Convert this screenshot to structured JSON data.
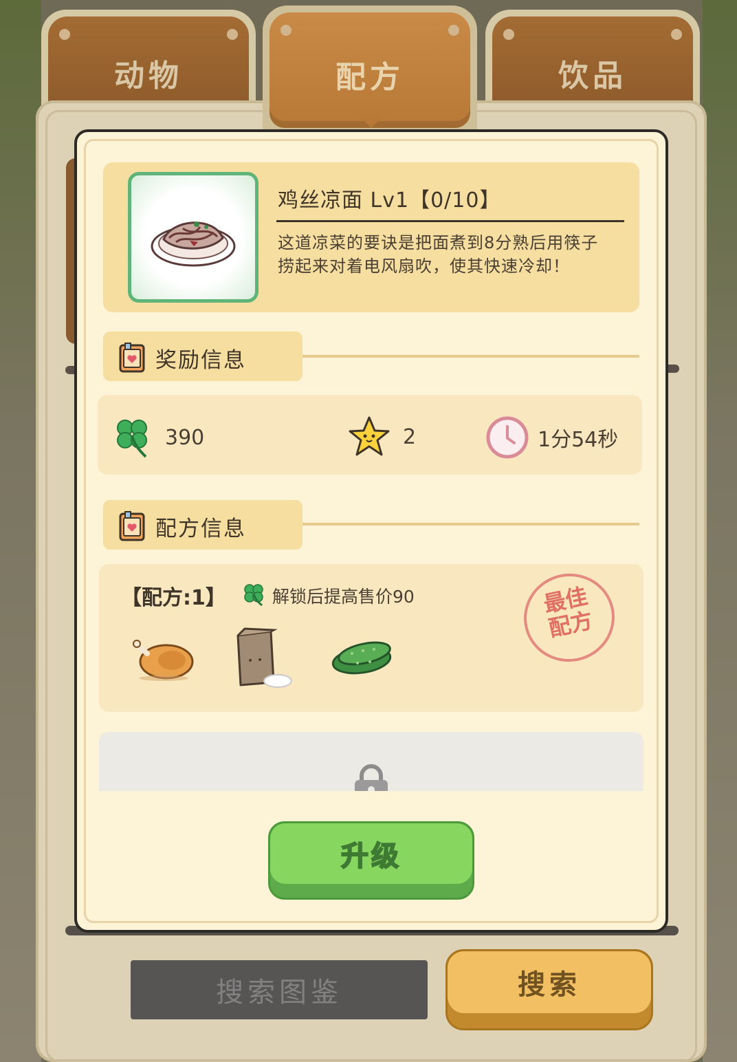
{
  "tabs": [
    {
      "label": "动物",
      "active": false
    },
    {
      "label": "配方",
      "active": true
    },
    {
      "label": "饮品",
      "active": false
    }
  ],
  "dish": {
    "image_icon": "noodle-plate-icon",
    "title": "鸡丝凉面 Lv1【0/10】",
    "description": "这道凉菜的要诀是把面煮到8分熟后用筷子捞起来对着电风扇吹，使其快速冷却！"
  },
  "reward_section": {
    "heading": "奖励信息",
    "clover": "390",
    "stars": "2",
    "time": "1分54秒"
  },
  "recipe_section": {
    "heading": "配方信息",
    "recipe_label": "【配方:1】",
    "unlock_note": "解锁后提高售价90",
    "stamp_line1": "最佳",
    "stamp_line2": "配方",
    "ingredients": [
      "roast-chicken-icon",
      "flour-bag-icon",
      "cucumber-icon"
    ]
  },
  "buttons": {
    "upgrade": "升级",
    "search_catalog": "搜索图鉴",
    "search": "搜索"
  },
  "colors": {
    "accent_green": "#86d660",
    "tab_brown": "#8d5a2a",
    "panel_bg": "#fdf3d6",
    "search_orange": "#f2c062"
  }
}
